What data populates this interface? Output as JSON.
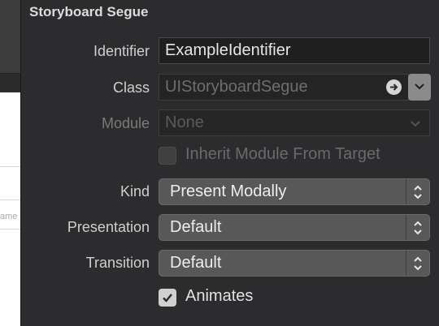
{
  "inspector": {
    "section_title": "Storyboard Segue",
    "identifier": {
      "label": "Identifier",
      "value": "ExampleIdentifier"
    },
    "class": {
      "label": "Class",
      "placeholder": "UIStoryboardSegue"
    },
    "module": {
      "label": "Module",
      "placeholder": "None"
    },
    "inherit_module": {
      "label": "Inherit Module From Target",
      "checked": false,
      "enabled": false
    },
    "kind": {
      "label": "Kind",
      "value": "Present Modally"
    },
    "presentation": {
      "label": "Presentation",
      "value": "Default"
    },
    "transition": {
      "label": "Transition",
      "value": "Default"
    },
    "animates": {
      "label": "Animates",
      "checked": true
    }
  },
  "background": {
    "peek_text": "ame"
  },
  "icons": [
    "arrow-circle-icon",
    "chevron-down-icon",
    "updown-chevron-icon",
    "checkmark-icon"
  ],
  "colors": {
    "panel_bg": "#2c2c2e",
    "popup_bg": "#585858",
    "text": "#e6e6e6",
    "disabled_text": "#6e6e6e"
  }
}
